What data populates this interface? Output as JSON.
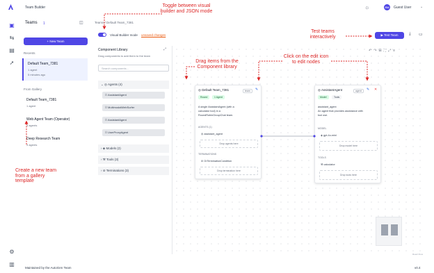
{
  "app": {
    "title": "Team Builder",
    "user_name": "Guest User",
    "user_initials": "GU"
  },
  "colors": {
    "accent": "#4f46e5",
    "annotation": "#dc2626",
    "warning": "#ea580c"
  },
  "rail": {
    "icons": [
      "team-builder-icon",
      "playground-icon",
      "gallery-icon",
      "deploy-icon"
    ],
    "bottom_icons": [
      "settings-icon",
      "docs-icon"
    ]
  },
  "sidebar": {
    "title": "Teams",
    "count": "1",
    "new_team_label": "+ New Team",
    "recents_label": "Recents",
    "recents": [
      {
        "name": "Default Team_7381",
        "meta": "1 agent",
        "sub": "5 minutes ago"
      }
    ],
    "gallery_label": "From Gallery",
    "gallery": [
      {
        "name": "Default Team_7381",
        "meta": "1 agent"
      },
      {
        "name": "Web Agent Team (Operator)",
        "meta": "3 agents"
      },
      {
        "name": "Deep Research Team",
        "meta": "3 agents"
      }
    ]
  },
  "toolbar": {
    "breadcrumb": "Teams / Default Team_7381",
    "visual_label": "Visual Builder mode",
    "unsaved_label": "unsaved changes",
    "test_label": "Test Team"
  },
  "library": {
    "title": "Component Library",
    "description": "Drag components to add them to the team",
    "search_placeholder": "Search components...",
    "sections": [
      {
        "label": "Agents (4)",
        "items": [
          "AssistantAgent",
          "MultimodalWebSurfer",
          "AssistantAgent",
          "UserProxyAgent"
        ]
      },
      {
        "label": "Models (2)"
      },
      {
        "label": "Tools (3)"
      },
      {
        "label": "Terminations (3)"
      }
    ]
  },
  "nodes": {
    "team": {
      "name": "Default Team_7381",
      "badge": "team",
      "pills": [
        "Round",
        "1 Agent"
      ],
      "desc_lines": [
        "A single AssistantAgent (with a",
        "calculator tool) in a",
        "RoundRobinGroupChat team."
      ],
      "agents_label": "AGENTS (1)",
      "agent": "assistant_agent",
      "drop_agents": "Drop agents here",
      "terminations_label": "TERMINATIONS",
      "termination": "OrTerminationCondition",
      "drop_terminations": "Drop termination here"
    },
    "agent": {
      "name": "AssistantAgent",
      "badge": "agent",
      "pills": [
        "Model",
        "Tools"
      ],
      "desc_lines": [
        "assistant_agent",
        "An agent that provides assistance with",
        "tool use."
      ],
      "model_label": "MODEL",
      "model": "gpt-4o-mini",
      "drop_model": "Drop model here",
      "tools_label": "TOOLS",
      "tool": "calculator",
      "drop_tools": "Drop tools here"
    }
  },
  "annotations": {
    "toggle": "Toggle between visual builder and JSON mode",
    "test": "Test teams interactively",
    "drag": "Drag items from the Component library",
    "edit": "Click on the edit icon to edit nodes",
    "create": "Create a new team from a gallery template"
  },
  "footer": {
    "left": "Maintained by the AutoGen Team",
    "right": "v0.4"
  }
}
